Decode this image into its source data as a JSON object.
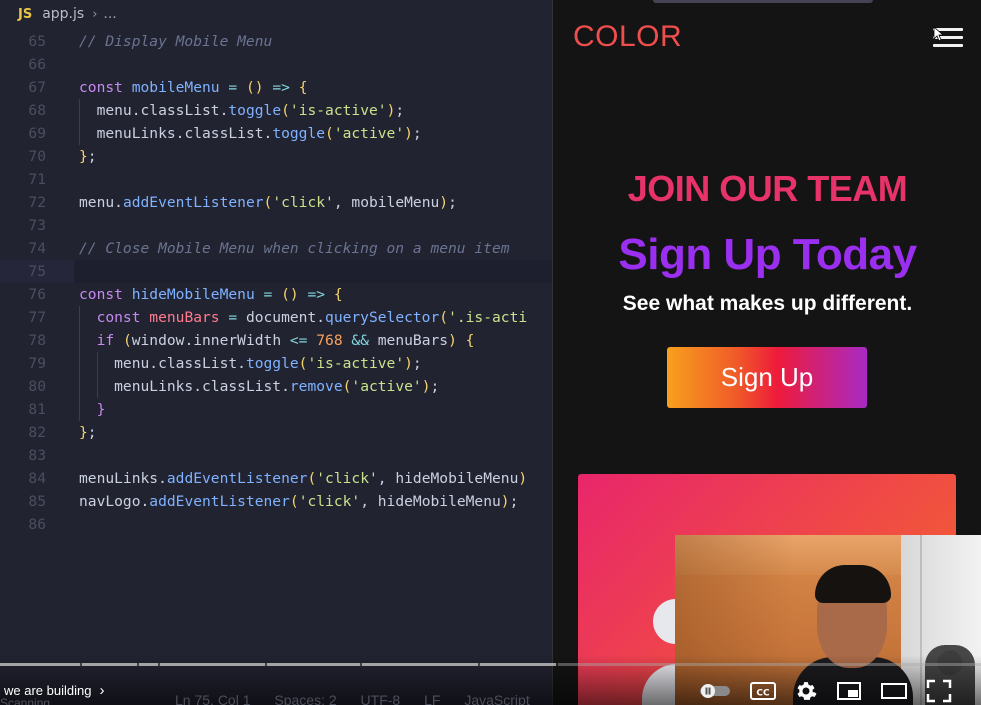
{
  "editor": {
    "tab": {
      "lang_badge": "JS",
      "filename": "app.js",
      "breadcrumb": "..."
    },
    "lines": [
      {
        "n": "65",
        "tokens": [
          [
            "com",
            "// Display Mobile Menu"
          ]
        ]
      },
      {
        "n": "66",
        "tokens": []
      },
      {
        "n": "67",
        "tokens": [
          [
            "kw",
            "const "
          ],
          [
            "fn",
            "mobileMenu"
          ],
          [
            "op",
            " = "
          ],
          [
            "br",
            "()"
          ],
          [
            "op",
            " => "
          ],
          [
            "br",
            "{"
          ]
        ]
      },
      {
        "n": "68",
        "tokens": [
          [
            "pl",
            "  menu."
          ],
          [
            "pl",
            "classList"
          ],
          [
            "pl",
            "."
          ],
          [
            "fn",
            "toggle"
          ],
          [
            "br",
            "("
          ],
          [
            "str",
            "'is-active'"
          ],
          [
            "br",
            ")"
          ],
          [
            "pl",
            ";"
          ]
        ]
      },
      {
        "n": "69",
        "tokens": [
          [
            "pl",
            "  menuLinks."
          ],
          [
            "pl",
            "classList"
          ],
          [
            "pl",
            "."
          ],
          [
            "fn",
            "toggle"
          ],
          [
            "br",
            "("
          ],
          [
            "str",
            "'active'"
          ],
          [
            "br",
            ")"
          ],
          [
            "pl",
            ";"
          ]
        ]
      },
      {
        "n": "70",
        "tokens": [
          [
            "br",
            "}"
          ],
          [
            "pl",
            ";"
          ]
        ]
      },
      {
        "n": "71",
        "tokens": []
      },
      {
        "n": "72",
        "tokens": [
          [
            "pl",
            "menu."
          ],
          [
            "fn",
            "addEventListener"
          ],
          [
            "br",
            "("
          ],
          [
            "str",
            "'click'"
          ],
          [
            "pl",
            ", mobileMenu"
          ],
          [
            "br",
            ")"
          ],
          [
            "pl",
            ";"
          ]
        ]
      },
      {
        "n": "73",
        "tokens": []
      },
      {
        "n": "74",
        "tokens": [
          [
            "com",
            "// Close Mobile Menu when clicking on a menu item"
          ]
        ]
      },
      {
        "n": "75",
        "tokens": [],
        "current": true
      },
      {
        "n": "76",
        "tokens": [
          [
            "kw",
            "const "
          ],
          [
            "fn",
            "hideMobileMenu"
          ],
          [
            "op",
            " = "
          ],
          [
            "br",
            "()"
          ],
          [
            "op",
            " => "
          ],
          [
            "br",
            "{"
          ]
        ]
      },
      {
        "n": "77",
        "tokens": [
          [
            "kw",
            "  const "
          ],
          [
            "var",
            "menuBars"
          ],
          [
            "op",
            " = "
          ],
          [
            "pl",
            "document."
          ],
          [
            "fn",
            "querySelector"
          ],
          [
            "br",
            "("
          ],
          [
            "str",
            "'.is-acti"
          ]
        ]
      },
      {
        "n": "78",
        "tokens": [
          [
            "kw",
            "  if "
          ],
          [
            "br",
            "("
          ],
          [
            "pl",
            "window.innerWidth "
          ],
          [
            "op",
            "<= "
          ],
          [
            "num",
            "768"
          ],
          [
            "op",
            " && "
          ],
          [
            "pl",
            "menuBars"
          ],
          [
            "br",
            ") {"
          ]
        ]
      },
      {
        "n": "79",
        "tokens": [
          [
            "pl",
            "    menu."
          ],
          [
            "pl",
            "classList"
          ],
          [
            "pl",
            "."
          ],
          [
            "fn",
            "toggle"
          ],
          [
            "br",
            "("
          ],
          [
            "str",
            "'is-active'"
          ],
          [
            "br",
            ")"
          ],
          [
            "pl",
            ";"
          ]
        ]
      },
      {
        "n": "80",
        "tokens": [
          [
            "pl",
            "    menuLinks."
          ],
          [
            "pl",
            "classList"
          ],
          [
            "pl",
            "."
          ],
          [
            "fn",
            "remove"
          ],
          [
            "br",
            "("
          ],
          [
            "str",
            "'active'"
          ],
          [
            "br",
            ")"
          ],
          [
            "pl",
            ";"
          ]
        ]
      },
      {
        "n": "81",
        "tokens": [
          [
            "kw",
            "  }"
          ]
        ]
      },
      {
        "n": "82",
        "tokens": [
          [
            "br",
            "}"
          ],
          [
            "pl",
            ";"
          ]
        ]
      },
      {
        "n": "83",
        "tokens": []
      },
      {
        "n": "84",
        "tokens": [
          [
            "pl",
            "menuLinks."
          ],
          [
            "fn",
            "addEventListener"
          ],
          [
            "br",
            "("
          ],
          [
            "str",
            "'click'"
          ],
          [
            "pl",
            ", hideMobileMenu"
          ],
          [
            "br",
            ")"
          ]
        ]
      },
      {
        "n": "85",
        "tokens": [
          [
            "pl",
            "navLogo."
          ],
          [
            "fn",
            "addEventListener"
          ],
          [
            "br",
            "("
          ],
          [
            "str",
            "'click'"
          ],
          [
            "pl",
            ", hideMobileMenu"
          ],
          [
            "br",
            ")"
          ],
          [
            "pl",
            ";"
          ]
        ]
      },
      {
        "n": "86",
        "tokens": []
      }
    ],
    "status": {
      "scanning": "Scanning",
      "position": "Ln 75, Col 1",
      "spaces": "Spaces: 2",
      "encoding": "UTF-8",
      "eol": "LF",
      "language": "JavaScript"
    }
  },
  "preview": {
    "logo": "COLOR",
    "heading": "JOIN OUR TEAM",
    "title": "Sign Up Today",
    "subtitle": "See what makes up different.",
    "button": "Sign Up",
    "colors": {
      "logo": "#ef4e4e",
      "heading": "#e8336a",
      "title": "#9b2ff0"
    }
  },
  "video": {
    "chapter": "we are building",
    "icons": [
      "autoplay-toggle-icon",
      "captions-icon",
      "settings-gear-icon",
      "miniplayer-icon",
      "theater-mode-icon",
      "fullscreen-icon"
    ],
    "cc_label": "CC"
  }
}
